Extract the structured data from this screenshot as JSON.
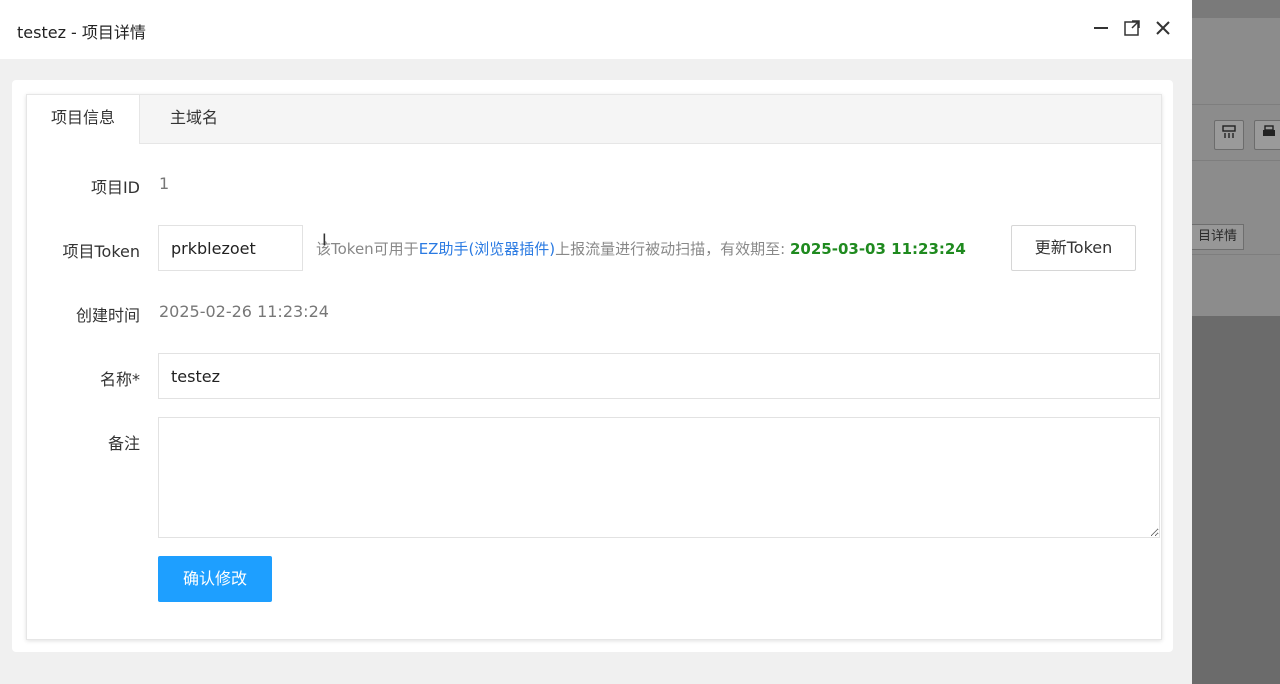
{
  "window": {
    "title": "testez - 项目详情"
  },
  "tabs": [
    {
      "label": "项目信息",
      "active": true
    },
    {
      "label": "主域名",
      "active": false
    }
  ],
  "form": {
    "project_id": {
      "label": "项目ID",
      "value": "1"
    },
    "project_token": {
      "label": "项目Token",
      "value": "prkblezoet",
      "hint_prefix": "该Token可用于",
      "hint_link": "EZ助手(浏览器插件)",
      "hint_middle": "上报流量进行被动扫描，有效期至: ",
      "expiry": "2025-03-03 11:23:24",
      "refresh_button": "更新Token"
    },
    "created_time": {
      "label": "创建时间",
      "value": "2025-02-26 11:23:24"
    },
    "name": {
      "label": "名称*",
      "value": "testez"
    },
    "remark": {
      "label": "备注",
      "value": ""
    },
    "submit_button": "确认修改"
  },
  "background_app": {
    "tag_text": "目详情"
  },
  "colors": {
    "primary": "#1e9fff",
    "link": "#2a7ae2",
    "expiry": "#1f8a1f"
  }
}
